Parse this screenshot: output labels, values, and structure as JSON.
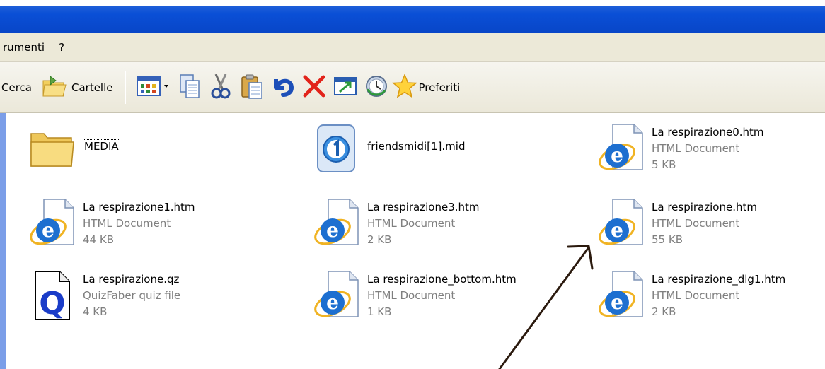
{
  "menubar": {
    "items": [
      "rumenti",
      "?"
    ]
  },
  "toolbar": {
    "search_label": "Cerca",
    "folders_label": "Cartelle",
    "favorites_label": "Preferiti"
  },
  "files": [
    {
      "name": "MEDIA",
      "type": "",
      "size": "",
      "icon": "folder-icon"
    },
    {
      "name": "friendsmidi[1].mid",
      "type": "",
      "size": "",
      "icon": "midi-file-icon"
    },
    {
      "name": "La respirazione0.htm",
      "type": "HTML Document",
      "size": "5 KB",
      "icon": "html-document-icon"
    },
    {
      "name": "La respirazione1.htm",
      "type": "HTML Document",
      "size": "44 KB",
      "icon": "html-document-icon"
    },
    {
      "name": "La respirazione3.htm",
      "type": "HTML Document",
      "size": "2 KB",
      "icon": "html-document-icon"
    },
    {
      "name": "La respirazione.htm",
      "type": "HTML Document",
      "size": "55 KB",
      "icon": "html-document-icon"
    },
    {
      "name": "La respirazione.qz",
      "type": "QuizFaber quiz file",
      "size": "4 KB",
      "icon": "quizfaber-file-icon"
    },
    {
      "name": "La respirazione_bottom.htm",
      "type": "HTML Document",
      "size": "1 KB",
      "icon": "html-document-icon"
    },
    {
      "name": "La respirazione_dlg1.htm",
      "type": "HTML Document",
      "size": "2 KB",
      "icon": "html-document-icon"
    }
  ]
}
